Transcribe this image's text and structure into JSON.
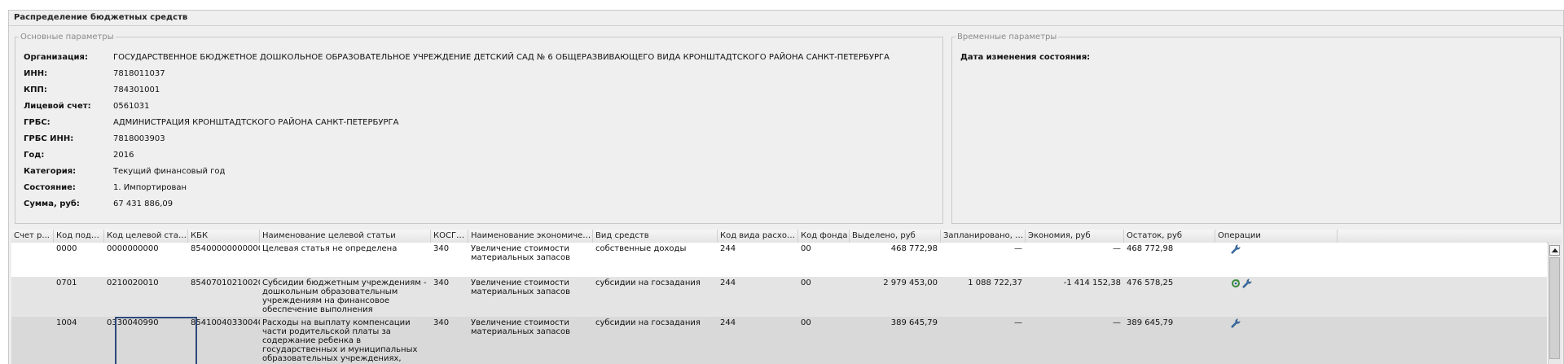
{
  "panel": {
    "title": "Распределение бюджетных средств"
  },
  "main_params": {
    "legend": "Основные параметры",
    "fields": [
      {
        "label": "Организация:",
        "value": "ГОСУДАРСТВЕННОЕ БЮДЖЕТНОЕ ДОШКОЛЬНОЕ ОБРАЗОВАТЕЛЬНОЕ УЧРЕЖДЕНИЕ ДЕТСКИЙ САД № 6 ОБЩЕРАЗВИВАЮЩЕГО ВИДА КРОНШТАДТСКОГО РАЙОНА САНКТ-ПЕТЕРБУРГА"
      },
      {
        "label": "ИНН:",
        "value": "7818011037"
      },
      {
        "label": "КПП:",
        "value": "784301001"
      },
      {
        "label": "Лицевой счет:",
        "value": "0561031"
      },
      {
        "label": "ГРБС:",
        "value": "АДМИНИСТРАЦИЯ КРОНШТАДТСКОГО РАЙОНА САНКТ-ПЕТЕРБУРГА"
      },
      {
        "label": "ГРБС ИНН:",
        "value": "7818003903"
      },
      {
        "label": "Год:",
        "value": "2016"
      },
      {
        "label": "Категория:",
        "value": "Текущий финансовый год"
      },
      {
        "label": "Состояние:",
        "value": "1. Импортирован"
      },
      {
        "label": "Сумма, руб:",
        "value": "67 431 886,09"
      }
    ]
  },
  "temp_params": {
    "legend": "Временные параметры",
    "label": "Дата изменения состояния:",
    "value": "-"
  },
  "table": {
    "columns": [
      "Счет р...",
      "Код подра...",
      "Код целевой статьи",
      "КБК",
      "Наименование целевой статьи",
      "КОСГУ...",
      "Наименование экономической ...",
      "Вид средств",
      "Код вида расходов",
      "Код фонда",
      "Выделено, руб",
      "Запланировано, руб",
      "Экономия, руб",
      "Остаток, руб",
      "Операции"
    ],
    "rows": [
      {
        "schet": "",
        "podr": "0000",
        "cs": "0000000000",
        "kbk": "85400000000000...",
        "name": "Целевая статья не определена",
        "kosgu": "340",
        "econ": "Увеличение стоимости материальных запасов",
        "vid": "собственные доходы",
        "kvr": "244",
        "fond": "00",
        "vydel": "468 772,98",
        "zapl": "—",
        "econom": "—",
        "ostatok": "468 772,98",
        "ops": [
          "wrench-icon"
        ]
      },
      {
        "schet": "",
        "podr": "0701",
        "cs": "0210020010",
        "kbk": "85407010210020...",
        "name": "Субсидии бюджетным учреждениям - дошкольным образовательным учреждениям на финансовое обеспечение выполнения государственного задания",
        "kosgu": "340",
        "econ": "Увеличение стоимости материальных запасов",
        "vid": "субсидии на госзадания",
        "kvr": "244",
        "fond": "00",
        "vydel": "2 979 453,00",
        "zapl": "1 088 722,37",
        "econom": "-1 414 152,38",
        "ostatok": "476 578,25",
        "ops": [
          "refresh-icon",
          "wrench-icon"
        ]
      },
      {
        "schet": "",
        "podr": "1004",
        "cs": "0330040990",
        "kbk": "85410040330040...",
        "name": "Расходы на выплату компенсации части родительской платы за содержание ребенка в государственных и муниципальных образовательных учреждениях, реализующих общеобразовательную программу дошкольного образования",
        "kosgu": "340",
        "econ": "Увеличение стоимости материальных запасов",
        "vid": "субсидии на госзадания",
        "kvr": "244",
        "fond": "00",
        "vydel": "389 645,79",
        "zapl": "—",
        "econom": "—",
        "ostatok": "389 645,79",
        "ops": [
          "wrench-icon"
        ]
      }
    ]
  }
}
